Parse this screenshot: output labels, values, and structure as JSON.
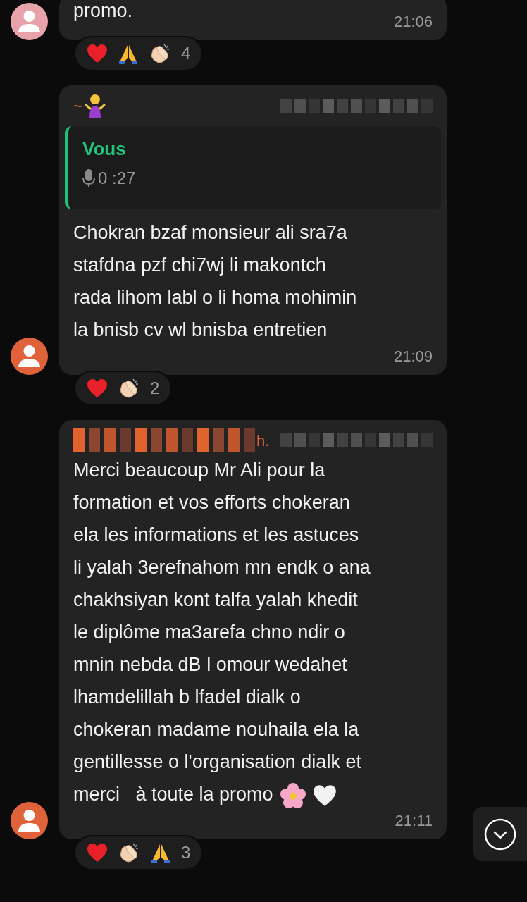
{
  "messages": [
    {
      "color": "#e8a2aa",
      "text": "promo.",
      "time": "21:06",
      "reactions": [
        {
          "kind": "heart"
        },
        {
          "kind": "pray"
        },
        {
          "kind": "clap"
        }
      ],
      "reaction_count": "4"
    },
    {
      "color": "#e0623a",
      "sender": "~",
      "sender_emoji": {
        "kind": "shrug"
      },
      "redacted_header": true,
      "quote": {
        "author": "Vous",
        "duration": "0 :27"
      },
      "text": "Chokran bzaf monsieur ali sra7a\nstafdna pzf chi7wj li makontch\nrada lihom labl o li homa mohimin\nla bnisb cv wl bnisba entretien",
      "time": "21:09",
      "reactions": [
        {
          "kind": "heart"
        },
        {
          "kind": "clap"
        }
      ],
      "reaction_count": "2"
    },
    {
      "color": "#e0623a",
      "sender": "h.",
      "redacted_sender": true,
      "redacted_header": true,
      "text": "Merci beaucoup Mr Ali pour la\nformation et vos efforts chokeran\nela les informations et les astuces\nli yalah 3erefnahom mn endk o ana\nchakhsiyan kont talfa yalah khedit\nle diplôme ma3arefa chno ndir o\nmnin nebda dB l omour wedahet\nlhamdelillah b lfadel dialk o\nchokeran madame nouhaila ela la\ngentillesse o l'organisation dialk et\nmerci   à toute la promo",
      "trailing_icons": [
        {
          "kind": "flower"
        },
        {
          "kind": "white-heart"
        }
      ],
      "time": "21:11",
      "reactions": [
        {
          "kind": "heart"
        },
        {
          "kind": "clap"
        },
        {
          "kind": "pray"
        }
      ],
      "reaction_count": "3"
    }
  ],
  "scroll_down_button": {
    "visible": true
  }
}
